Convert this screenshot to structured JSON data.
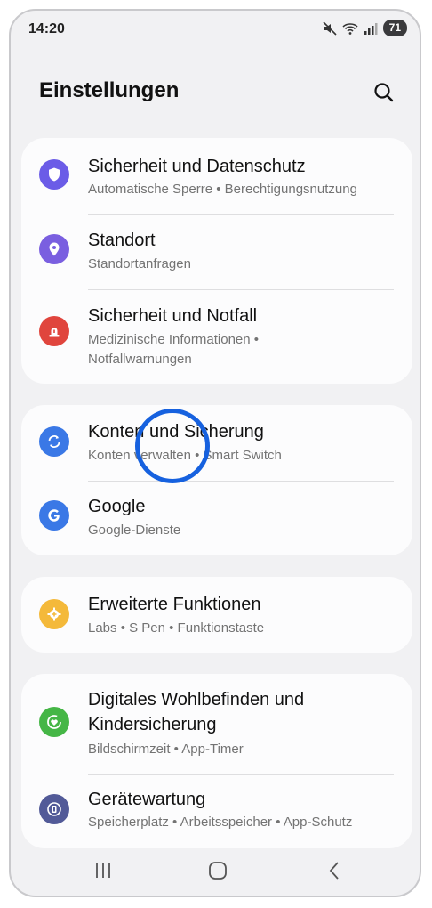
{
  "status": {
    "time": "14:20",
    "battery": "71",
    "icons": [
      "mute-icon",
      "wifi-icon",
      "signal-icon",
      "battery-icon"
    ]
  },
  "header": {
    "title": "Einstellungen",
    "search_icon": "search-icon"
  },
  "groups": [
    {
      "items": [
        {
          "title": "Sicherheit und Datenschutz",
          "subtitle": "Automatische Sperre • Berechtigungsnutzung",
          "icon": "shield-icon",
          "color": "#6b5ce7"
        },
        {
          "title": "Standort",
          "subtitle": "Standortanfragen",
          "icon": "location-pin-icon",
          "color": "#7a5fe0"
        },
        {
          "title": "Sicherheit und Notfall",
          "subtitle_line1": "Medizinische Informationen •",
          "subtitle_line2": "Notfallwarnungen",
          "icon": "emergency-siren-icon",
          "color": "#e0453d"
        }
      ]
    },
    {
      "items": [
        {
          "title": "Konten und Sicherung",
          "subtitle": "Konten verwalten • Smart Switch",
          "icon": "sync-icon",
          "color": "#3a78e6"
        },
        {
          "title": "Google",
          "subtitle": "Google-Dienste",
          "icon": "google-icon",
          "color": "#3a78e6"
        }
      ]
    },
    {
      "items": [
        {
          "title": "Erweiterte Funktionen",
          "subtitle": "Labs • S Pen • Funktionstaste",
          "icon": "gear-plus-icon",
          "color": "#f4b93a"
        }
      ]
    },
    {
      "items": [
        {
          "title_line1": "Digitales Wohlbefinden und",
          "title_line2": "Kindersicherung",
          "subtitle": "Bildschirmzeit • App-Timer",
          "icon": "wellbeing-icon",
          "color": "#45b646"
        },
        {
          "title": "Gerätewartung",
          "subtitle": "Speicherplatz • Arbeitsspeicher • App-Schutz",
          "icon": "device-care-icon",
          "color": "#525a98"
        }
      ]
    }
  ],
  "navbar": {
    "recents_icon": "recents-icon",
    "home_icon": "home-icon",
    "back_icon": "back-icon"
  }
}
